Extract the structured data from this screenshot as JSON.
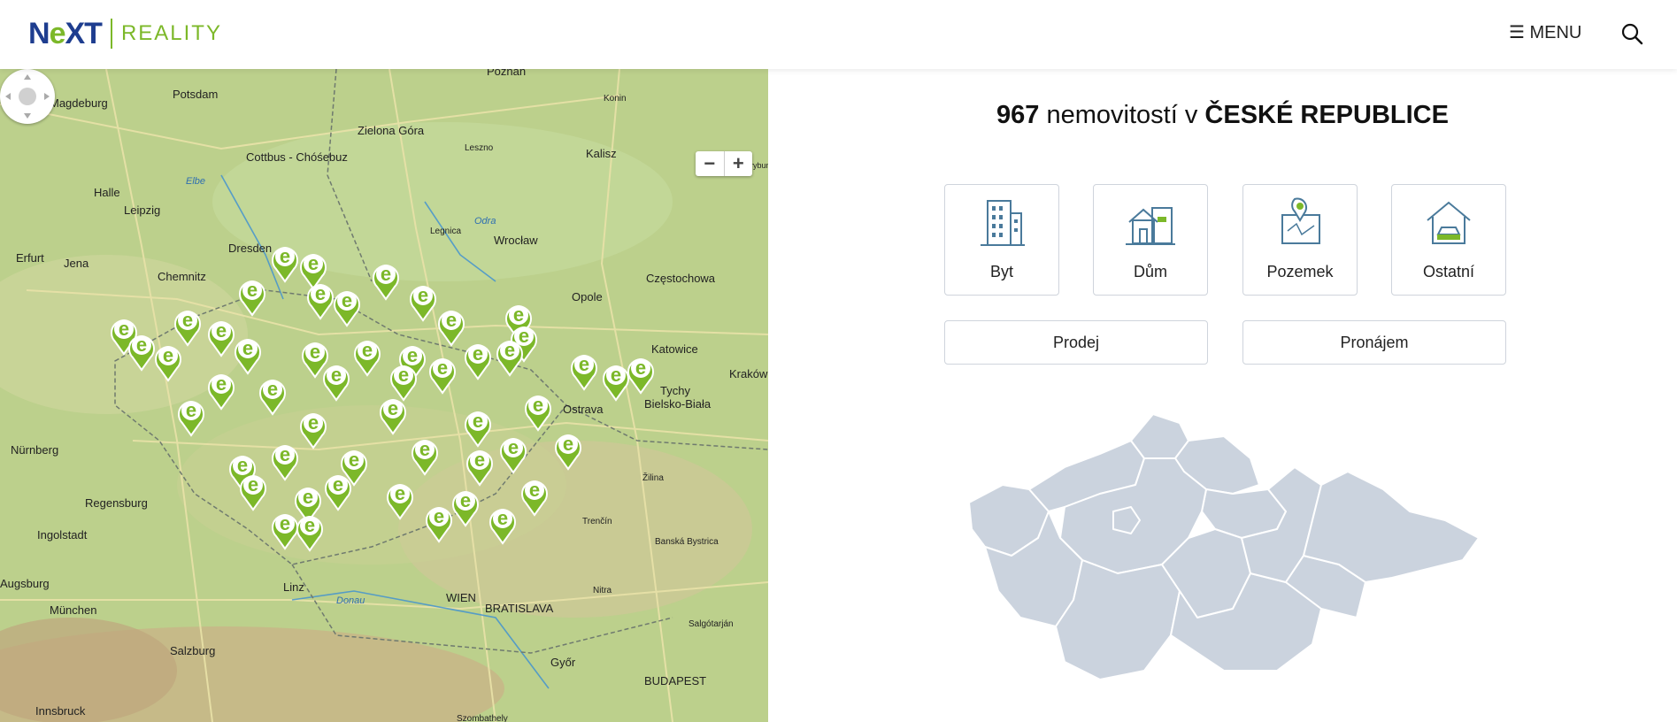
{
  "header": {
    "logo_main_prefix": "N",
    "logo_main_e": "e",
    "logo_main_suffix": "XT",
    "logo_sub": "REALITY",
    "menu_label": "☰ MENU",
    "search_icon": "search-icon"
  },
  "map": {
    "zoom_out": "−",
    "zoom_in": "+",
    "labels": [
      {
        "text": "Magdeburg"
      },
      {
        "text": "Potsdam"
      },
      {
        "text": "Poznań"
      },
      {
        "text": "Konin"
      },
      {
        "text": "Zielona Góra"
      },
      {
        "text": "Leszno"
      },
      {
        "text": "Kalisz"
      },
      {
        "text": "Cottbus - Chóśebuz"
      },
      {
        "text": "Halle"
      },
      {
        "text": "Leipzig"
      },
      {
        "text": "Erfurt"
      },
      {
        "text": "Jena"
      },
      {
        "text": "Chemnitz"
      },
      {
        "text": "Dresden"
      },
      {
        "text": "Legnica"
      },
      {
        "text": "Wrocław"
      },
      {
        "text": "Opole"
      },
      {
        "text": "Częstochowa"
      },
      {
        "text": "Katowice"
      },
      {
        "text": "Tychy"
      },
      {
        "text": "Bielsko-Biała"
      },
      {
        "text": "Kraków"
      },
      {
        "text": "Ostrava"
      },
      {
        "text": "Nürnberg"
      },
      {
        "text": "Regensburg"
      },
      {
        "text": "Ingolstadt"
      },
      {
        "text": "Augsburg"
      },
      {
        "text": "München"
      },
      {
        "text": "Linz"
      },
      {
        "text": "WIEN"
      },
      {
        "text": "BRATISLAVA"
      },
      {
        "text": "Salzburg"
      },
      {
        "text": "Győr"
      },
      {
        "text": "BUDAPEST"
      },
      {
        "text": "Nitra"
      },
      {
        "text": "Žilina"
      },
      {
        "text": "Trenčín"
      },
      {
        "text": "Banská Bystrica"
      },
      {
        "text": "Salgótarján"
      },
      {
        "text": "Innsbruck"
      },
      {
        "text": "Szombathely"
      },
      {
        "text": "Piotrków Trybunalski"
      },
      {
        "text": "Odra"
      },
      {
        "text": "Elbe"
      },
      {
        "text": "Donau"
      }
    ]
  },
  "summary": {
    "count": "967",
    "text": "nemovitostí v",
    "country": "ČESKÉ REPUBLICE"
  },
  "categories": [
    {
      "label": "Byt",
      "icon": "building-icon"
    },
    {
      "label": "Dům",
      "icon": "house-icon"
    },
    {
      "label": "Pozemek",
      "icon": "land-plot-icon"
    },
    {
      "label": "Ostatní",
      "icon": "garage-icon"
    }
  ],
  "deal_types": [
    {
      "label": "Prodej"
    },
    {
      "label": "Pronájem"
    }
  ],
  "colors": {
    "brand_green": "#7cb829",
    "brand_blue": "#1e3d8f",
    "region_fill": "#cbd3de",
    "icon_blue": "#4a7a9b"
  }
}
